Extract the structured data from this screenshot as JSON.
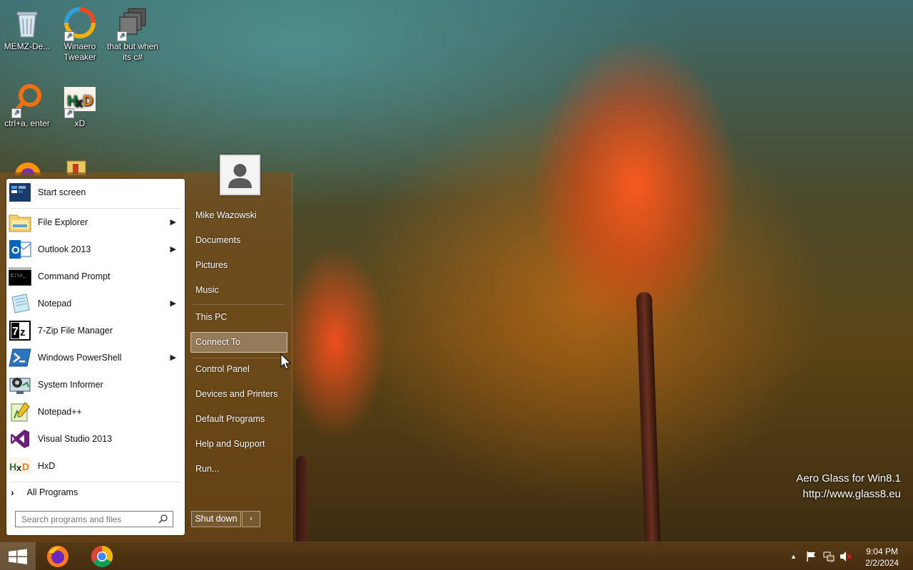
{
  "desktop": {
    "icons": [
      {
        "label": "MEMZ-De...",
        "icon": "recycle-bin-icon"
      },
      {
        "label": "Winaero Tweaker",
        "icon": "winaero-icon"
      },
      {
        "label": "that but when its c#",
        "icon": "stacked-windows-icon"
      },
      {
        "label": "ctrl+a, enter",
        "icon": "search-ring-icon"
      },
      {
        "label": "xD",
        "icon": "hxd-icon"
      }
    ],
    "watermark": {
      "line1": "Aero Glass for Win8.1",
      "line2": "http://www.glass8.eu"
    }
  },
  "start_menu": {
    "programs": [
      {
        "label": "Start screen",
        "icon": "start-screen-icon",
        "submenu": false
      },
      {
        "label": "File Explorer",
        "icon": "folder-icon",
        "submenu": true
      },
      {
        "label": "Outlook 2013",
        "icon": "outlook-icon",
        "submenu": true
      },
      {
        "label": "Command Prompt",
        "icon": "terminal-icon",
        "submenu": false
      },
      {
        "label": "Notepad",
        "icon": "notepad-icon",
        "submenu": true
      },
      {
        "label": "7-Zip File Manager",
        "icon": "7zip-icon",
        "submenu": false
      },
      {
        "label": "Windows PowerShell",
        "icon": "powershell-icon",
        "submenu": true
      },
      {
        "label": "System Informer",
        "icon": "system-informer-icon",
        "submenu": false
      },
      {
        "label": "Notepad++",
        "icon": "notepadpp-icon",
        "submenu": false
      },
      {
        "label": "Visual Studio 2013",
        "icon": "visual-studio-icon",
        "submenu": false
      },
      {
        "label": "HxD",
        "icon": "hxd-icon",
        "submenu": false
      }
    ],
    "all_programs": "All Programs",
    "search_placeholder": "Search programs and files",
    "user_name": "Mike Wazowski",
    "right_links": {
      "documents": "Documents",
      "pictures": "Pictures",
      "music": "Music",
      "this_pc": "This PC",
      "connect_to": "Connect To",
      "control_panel": "Control Panel",
      "devices": "Devices and Printers",
      "default_programs": "Default Programs",
      "help": "Help and Support",
      "run": "Run..."
    },
    "shut_down": "Shut down",
    "shut_down_arrow": "›"
  },
  "taskbar": {
    "pinned": [
      "firefox-icon",
      "chrome-icon"
    ],
    "time": "9:04 PM",
    "date": "2/2/2024",
    "tray_icons": [
      "show-hidden-icons",
      "action-center-flag-icon",
      "network-icon",
      "volume-muted-icon"
    ]
  },
  "colors": {
    "accent": "#7a5020",
    "highlight": "rgba(255,255,255,0.28)"
  }
}
